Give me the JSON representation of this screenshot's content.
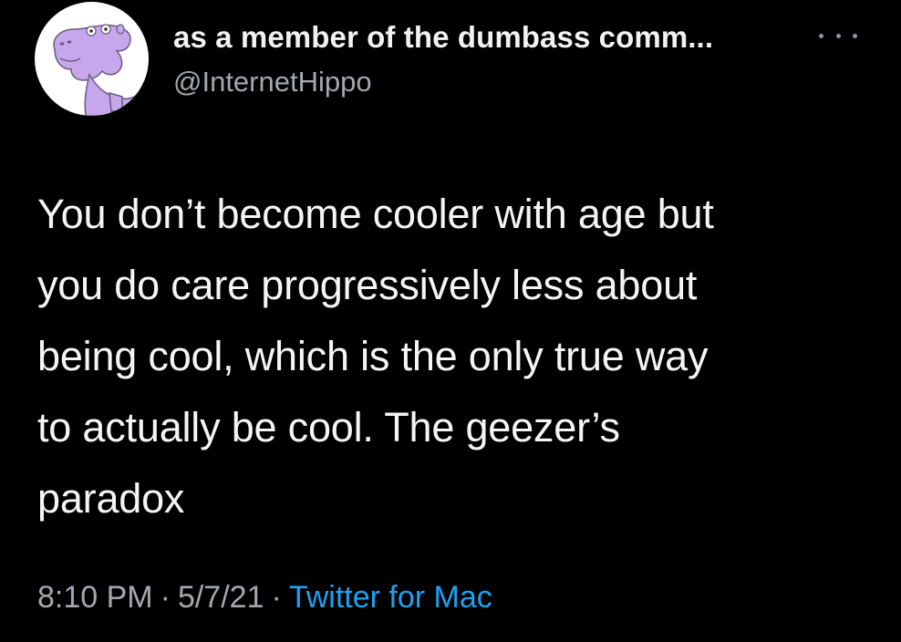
{
  "author": {
    "display_name": "as a member of the dumbass comm...",
    "handle": "@InternetHippo",
    "avatar_icon": "hippo-avatar-icon"
  },
  "more_icon": "more-options-icon",
  "tweet": {
    "lines": [
      "You don’t become cooler with age but",
      "you do care progressively less about",
      "being cool, which is the only true way",
      "to actually be cool. The geezer’s",
      "paradox"
    ]
  },
  "meta": {
    "time": "8:10 PM",
    "separator": "·",
    "date": "5/7/21",
    "source": "Twitter for Mac"
  },
  "colors": {
    "background": "#000000",
    "text": "#f5f5f5",
    "secondary": "#a2a8ad",
    "link": "#1da1f2",
    "avatar_bg": "#ffffff",
    "hippo": "#c7a7ec"
  }
}
